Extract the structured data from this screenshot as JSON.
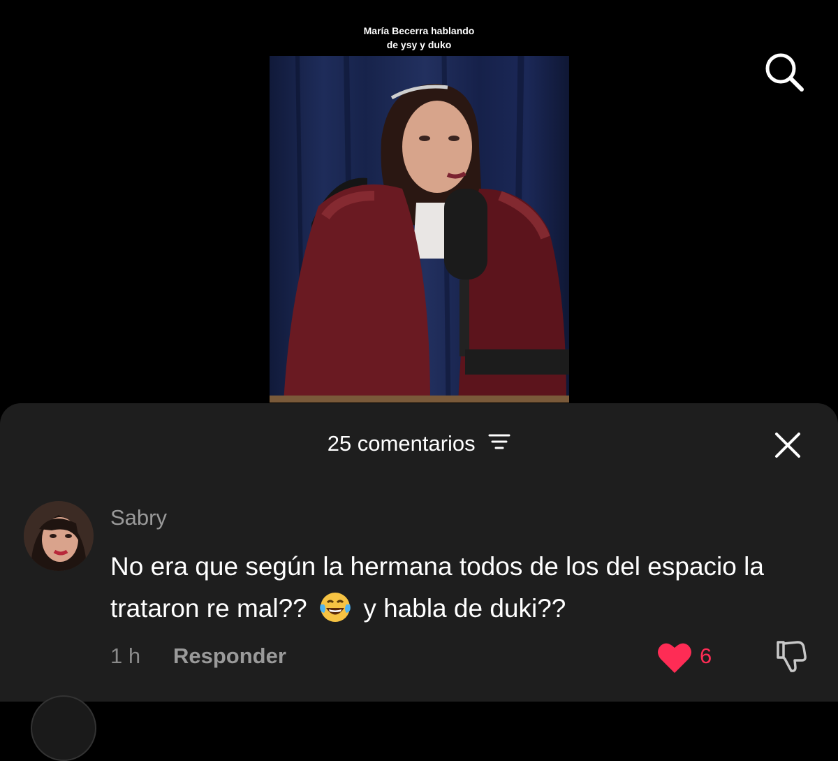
{
  "video": {
    "caption_line1": "María Becerra hablando",
    "caption_line2": "de ysy y duko"
  },
  "comments_panel": {
    "header": "25 comentarios",
    "comment": {
      "username": "Sabry",
      "text_before_emoji": "No era que según la hermana todos de los del espacio la trataron re mal??",
      "emoji": "😂",
      "text_after_emoji": "y habla de duki??",
      "time": "1 h",
      "reply_label": "Responder",
      "like_count": "6"
    }
  },
  "colors": {
    "like": "#fe2c55",
    "sheet_bg": "#1e1e1e",
    "muted_text": "#9a9a9a"
  },
  "icons": [
    "search-icon",
    "filter-icon",
    "close-icon",
    "heart-icon",
    "dislike-icon"
  ]
}
